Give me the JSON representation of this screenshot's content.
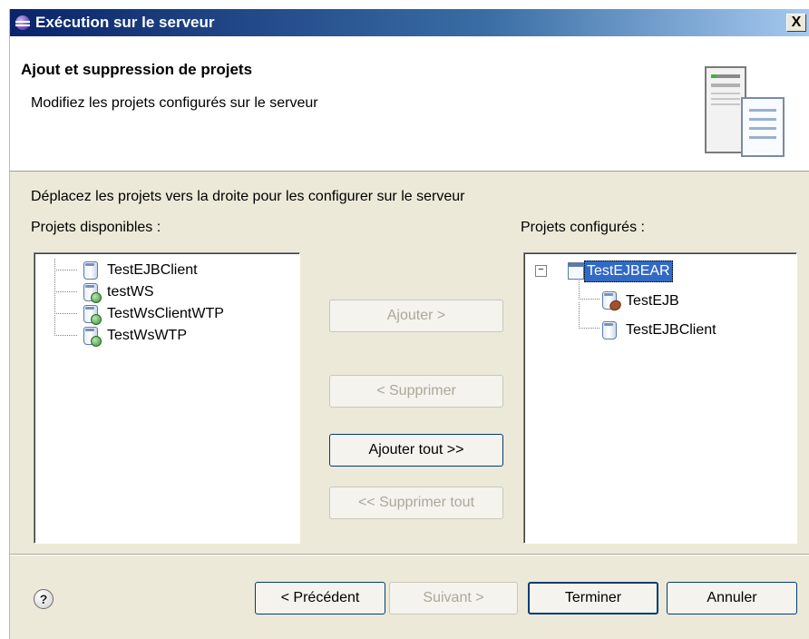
{
  "window": {
    "title": "Exécution sur le serveur",
    "close_label": "X"
  },
  "header": {
    "title": "Ajout et suppression de projets",
    "description": "Modifiez les projets configurés sur le serveur",
    "icon": "server-icon"
  },
  "instructions": "Déplacez les projets vers la droite pour les configurer sur le serveur",
  "available": {
    "label": "Projets disponibles :",
    "items": [
      {
        "label": "TestEJBClient",
        "icon": "jar-icon"
      },
      {
        "label": "testWS",
        "icon": "web-module-icon"
      },
      {
        "label": "TestWsClientWTP",
        "icon": "web-module-icon"
      },
      {
        "label": "TestWsWTP",
        "icon": "web-module-icon"
      }
    ]
  },
  "configured": {
    "label": "Projets configurés :",
    "root": {
      "label": "TestEJBEAR",
      "icon": "ear-icon",
      "expander": "−"
    },
    "children": [
      {
        "label": "TestEJB",
        "icon": "ejb-icon"
      },
      {
        "label": "TestEJBClient",
        "icon": "jar-icon"
      }
    ]
  },
  "buttons": {
    "add": "Ajouter >",
    "remove": "< Supprimer",
    "add_all": "Ajouter tout >>",
    "remove_all": "<< Supprimer tout"
  },
  "footer": {
    "help": "?",
    "previous": "< Précédent",
    "next": "Suivant >",
    "finish": "Terminer",
    "cancel": "Annuler"
  }
}
